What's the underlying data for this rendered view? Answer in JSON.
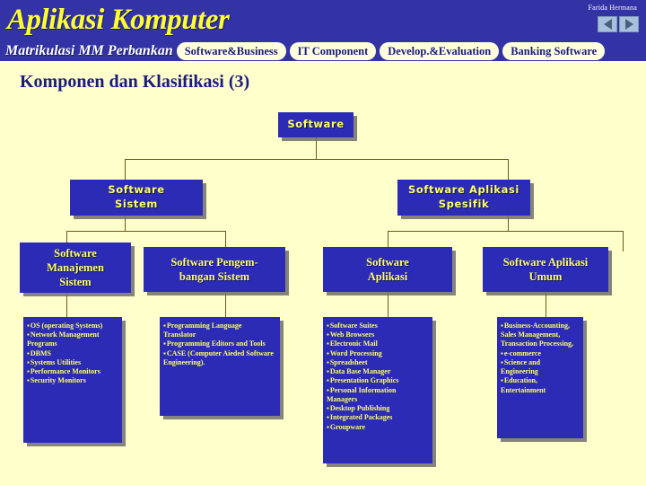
{
  "header": {
    "app_title": "Aplikasi Komputer",
    "author": "Farida Hermana",
    "course_label": "Matrikulasi MM Perbankan",
    "tabs": [
      {
        "label": "Software&Business"
      },
      {
        "label": "IT Component"
      },
      {
        "label": "Develop.&Evaluation"
      },
      {
        "label": "Banking Software"
      }
    ],
    "prev_icon": "triangle-left-icon",
    "next_icon": "triangle-right-icon"
  },
  "page_title": "Komponen dan Klasifikasi (3)",
  "diagram": {
    "root": {
      "label": "Software"
    },
    "level2": [
      {
        "label": "Software\nSistem"
      },
      {
        "label": "Software Aplikasi\nSpesifik"
      }
    ],
    "level3": [
      {
        "label": "Software\nManajemen\nSistem"
      },
      {
        "label": "Software Pengem-\nbangan Sistem"
      },
      {
        "label": "Software\nAplikasi"
      },
      {
        "label": "Software Aplikasi\nUmum"
      }
    ],
    "leaves": [
      {
        "items": [
          "OS (operating Systems)",
          "Network Management Programs",
          "DBMS",
          "Systems Utilities",
          "Performance Monitors",
          "Security Monitors"
        ]
      },
      {
        "items": [
          "Programming Language Translator",
          "Programming Editors and Tools",
          "CASE (Computer Aieded Software Engineering)."
        ]
      },
      {
        "items": [
          "Software Suites",
          "Web Browsers",
          "Electronic Mail",
          "Word Processing",
          "Spreadsheet",
          "Data Base Manager",
          "Presentation Graphics",
          "Personal Information Managers",
          "Desktop Publishing",
          "Integrated Packages",
          "Groupware"
        ]
      },
      {
        "items": [
          "Business-Accounting, Sales Management, Transaction Processing,",
          "e-commerce",
          "Science and Engineering",
          "Education, Entertainment"
        ]
      }
    ]
  },
  "colors": {
    "background": "#FFFFCC",
    "header_blue": "#3333A6",
    "node_blue": "#2B2BB5",
    "title_yellow": "#FFFF33",
    "node_text_yellow": "#FFFF66",
    "tab_cream": "#FFFFE0",
    "tab_text_navy": "#1a1a80",
    "connector": "#6b5a16"
  }
}
